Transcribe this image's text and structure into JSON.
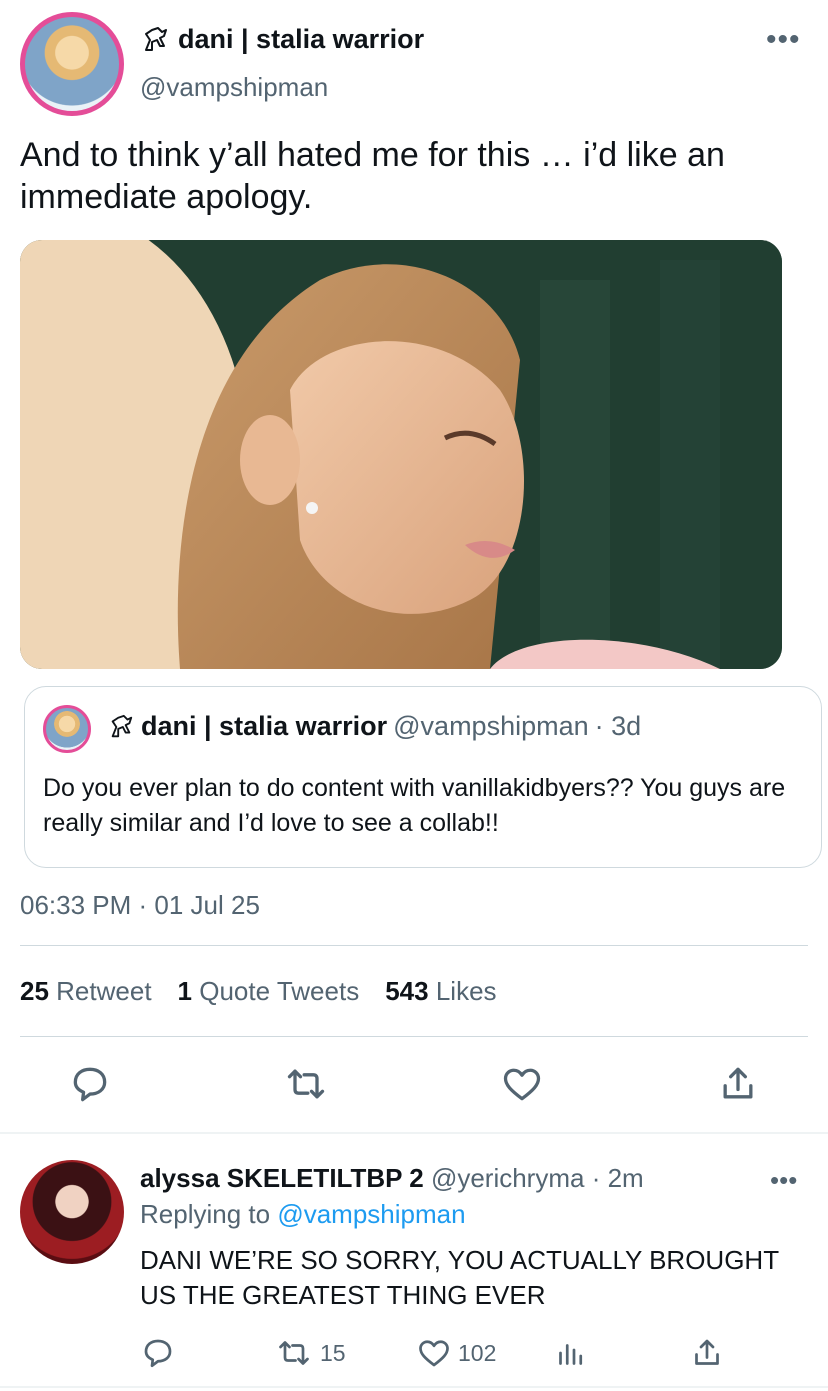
{
  "tweet": {
    "display_name": "dani | stalia warrior",
    "handle": "@vampshipman",
    "more_icon": "more-horizontal-icon",
    "text": "And to think y’all hated me for this … i’d like an immediate apology.",
    "timestamp": "06:33 PM · 01 Jul 25",
    "stats": {
      "retweets_count": "25",
      "retweets_label": "Retweet",
      "quotes_count": "1",
      "quotes_label": "Quote Tweets",
      "likes_count": "543",
      "likes_label": "Likes"
    },
    "actions": [
      "reply-icon",
      "retweet-icon",
      "like-icon",
      "share-icon"
    ]
  },
  "quote": {
    "display_name": "dani | stalia warrior",
    "handle": "@vampshipman",
    "time": "· 3d",
    "text": "Do you ever plan to do content with vanillakidbyers?? You guys are really similar and I’d love to see a collab!!"
  },
  "reply": {
    "display_name": "alyssa SKELETILTBP 2",
    "handle": "@yerichryma",
    "time": "· 2m",
    "replying_prefix": "Replying to",
    "replying_to": "@vampshipman",
    "text": "DANI WE’RE SO SORRY, YOU ACTUALLY BROUGHT US THE GREATEST THING EVER",
    "retweets": "15",
    "likes": "102"
  },
  "colors": {
    "accent": "#1d9bf0",
    "secondary_text": "#536471",
    "avatar_ring": "#e44d98"
  }
}
